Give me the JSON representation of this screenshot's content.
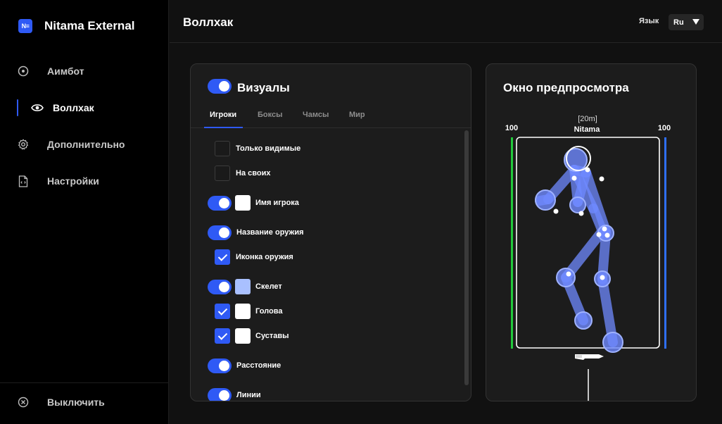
{
  "app": {
    "title": "Nitama External",
    "logo_text": "N≡"
  },
  "sidebar": {
    "items": [
      {
        "label": "Аимбот",
        "icon": "target-icon"
      },
      {
        "label": "Воллхак",
        "icon": "eye-icon",
        "active": true
      },
      {
        "label": "Дополнительно",
        "icon": "gear-icon"
      },
      {
        "label": "Настройки",
        "icon": "file-code-icon"
      }
    ],
    "logout_label": "Выключить"
  },
  "header": {
    "title": "Воллхак",
    "lang_label": "Язык",
    "lang_value": "Ru"
  },
  "visuals": {
    "title": "Визуалы",
    "enabled": true,
    "tabs": [
      "Игроки",
      "Боксы",
      "Чамсы",
      "Мир"
    ],
    "active_tab": "Игроки",
    "options": {
      "only_visible": "Только видимые",
      "on_own": "На своих",
      "player_name": "Имя игрока",
      "weapon_name": "Название оружия",
      "weapon_icon": "Иконка оружия",
      "skeleton": "Скелет",
      "head": "Голова",
      "joints": "Суставы",
      "distance": "Расстояние",
      "lines": "Линии"
    },
    "colors": {
      "accent": "#2f5af5",
      "player_name_color": "#ffffff",
      "skeleton_color": "#a9c0ff",
      "head_color": "#ffffff",
      "joints_color": "#ffffff"
    }
  },
  "preview": {
    "title": "Окно предпросмотра",
    "distance": "[20m]",
    "name": "Nitama",
    "health": "100",
    "armor": "100",
    "colors": {
      "health_bar": "#22c93c",
      "armor_bar": "#2f6ff5",
      "skeleton": "#6f89ff"
    }
  }
}
